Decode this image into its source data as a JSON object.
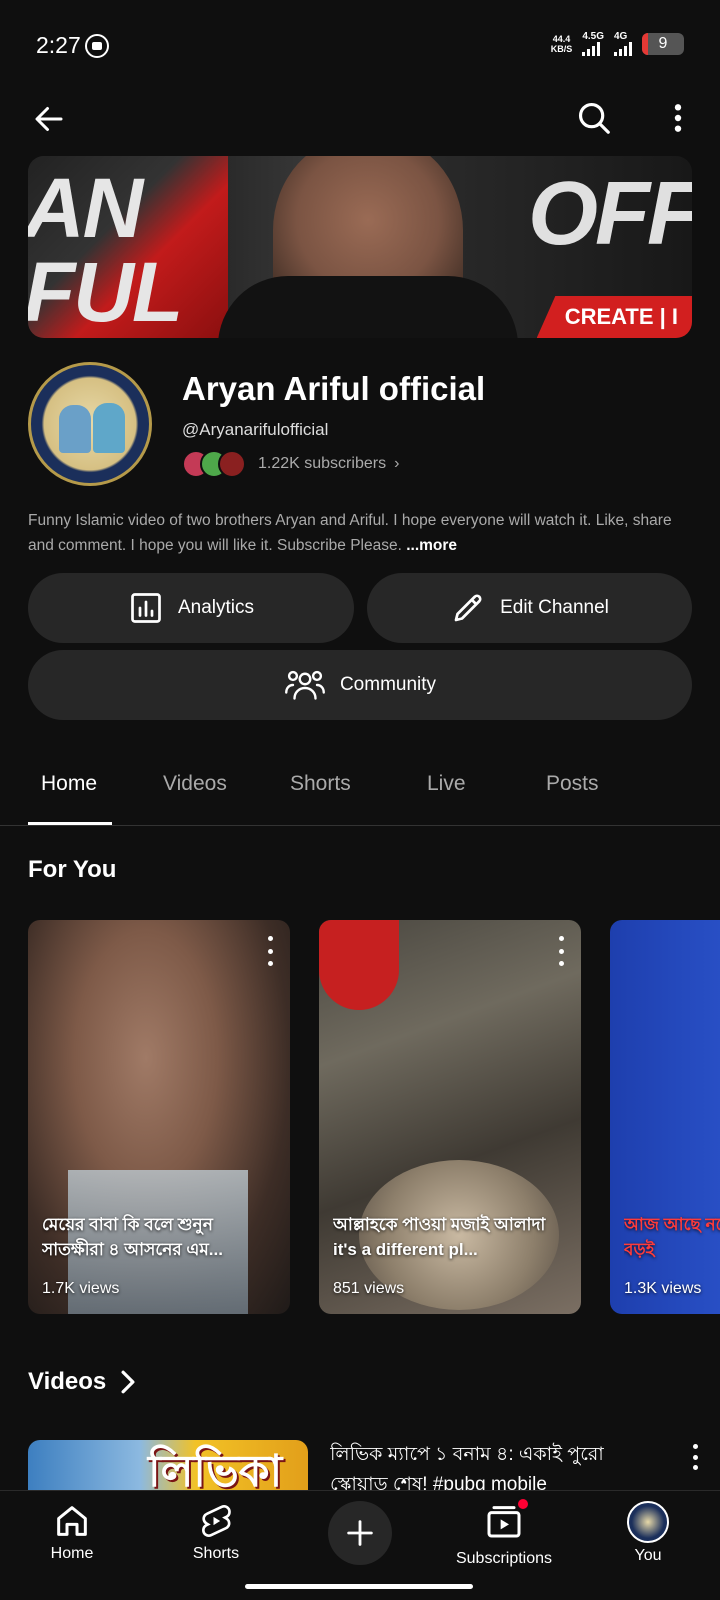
{
  "status_bar": {
    "time": "2:27",
    "net_speed_value": "44.4",
    "net_speed_unit": "KB/S",
    "signal1_label": "4.5G",
    "signal2_label": "4G",
    "battery": "9"
  },
  "channel": {
    "name": "Aryan Ariful official",
    "handle": "@Aryanarifulofficial",
    "subscribers": "1.22K subscribers",
    "description": "Funny Islamic video of two brothers Aryan and Ariful. I hope everyone will watch it. Like, share and comment. I hope you will like it. Subscribe Please.",
    "more_label": "...more",
    "banner_left_text": "AN\nFUL",
    "banner_right_text": "OFFI",
    "banner_create": "CREATE | I"
  },
  "actions": {
    "analytics": "Analytics",
    "edit_channel": "Edit Channel",
    "community": "Community"
  },
  "tabs": [
    "Home",
    "Videos",
    "Shorts",
    "Live",
    "Posts"
  ],
  "for_you": {
    "title": "For You",
    "shorts": [
      {
        "title": "মেয়ের বাবা কি বলে শুনুন সাতক্ষীরা ৪ আসনের এম...",
        "views": "1.7K views"
      },
      {
        "title": "আল্লাহকে পাওয়া মজাই আলাদা it's a different pl...",
        "views": "851 views"
      },
      {
        "title": "আজ আছে নরে তোমার জীবন বড়ই",
        "views": "1.3K views"
      }
    ]
  },
  "videos": {
    "title": "Videos",
    "first_video_title": "লিভিক ম্যাপে ১ বনাম ৪: একাই পুরো স্কোয়াড শেষ! #pubg mobile",
    "first_video_thumb_text": "লিভিকা"
  },
  "bottom_nav": {
    "home": "Home",
    "shorts": "Shorts",
    "subscriptions": "Subscriptions",
    "you": "You"
  }
}
